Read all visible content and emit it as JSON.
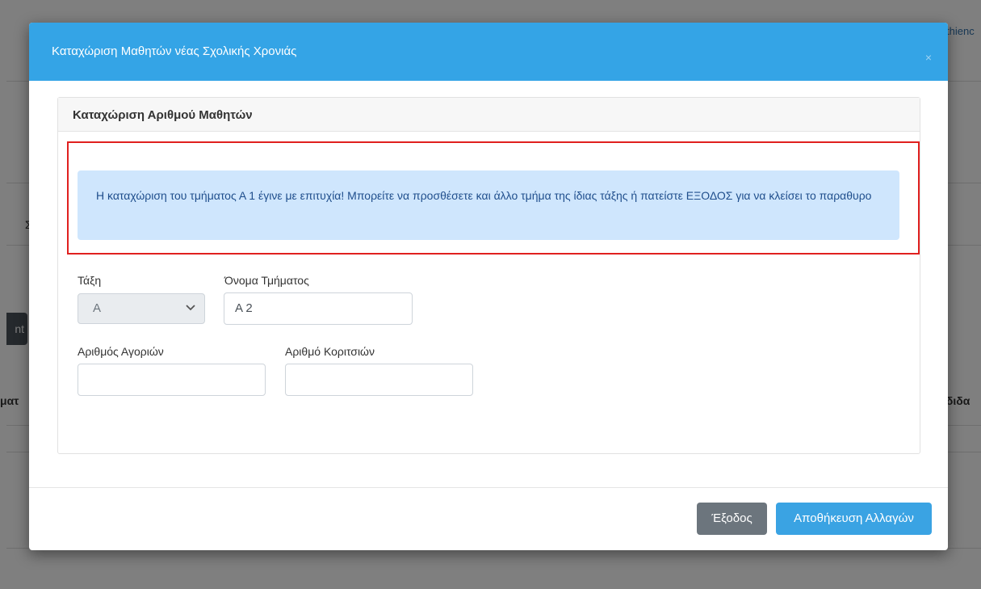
{
  "background": {
    "corner_text": "thienc",
    "row_text_1": "ματ",
    "row_text_2": "ιδιδα",
    "left_button_label": "nt",
    "small_text": "Σ"
  },
  "modal": {
    "title": "Καταχώριση Μαθητών νέας Σχολικής Χρονιάς",
    "close_label": "×",
    "card": {
      "title": "Καταχώριση Αριθμού Μαθητών",
      "alert": "Η καταχώριση του τμήματος Α 1 έγινε με επιτυχία! Μπορείτε να προσθέσετε και άλλο τμήμα της ίδιας τάξης ή πατείστε ΕΞΟΔΟΣ για να κλείσει το παραθυρο",
      "fields": {
        "class_label": "Τάξη",
        "class_value": "Α",
        "section_label": "Όνομα Τμήματος",
        "section_value": "Α 2",
        "boys_label": "Αριθμός Αγοριών",
        "boys_value": "",
        "girls_label": "Αριθμό Κοριτσιών",
        "girls_value": ""
      }
    },
    "footer": {
      "exit_label": "Έξοδος",
      "save_label": "Αποθήκευση Αλλαγών"
    }
  },
  "icons": {
    "select_arrow": "chevron-down-icon",
    "close": "close-icon"
  },
  "colors": {
    "header": "#34a4e6",
    "alert_bg": "#cfe6fd",
    "highlight_border": "#e0201f",
    "exit_button": "#6c757d",
    "save_button": "#3aa3e3"
  }
}
